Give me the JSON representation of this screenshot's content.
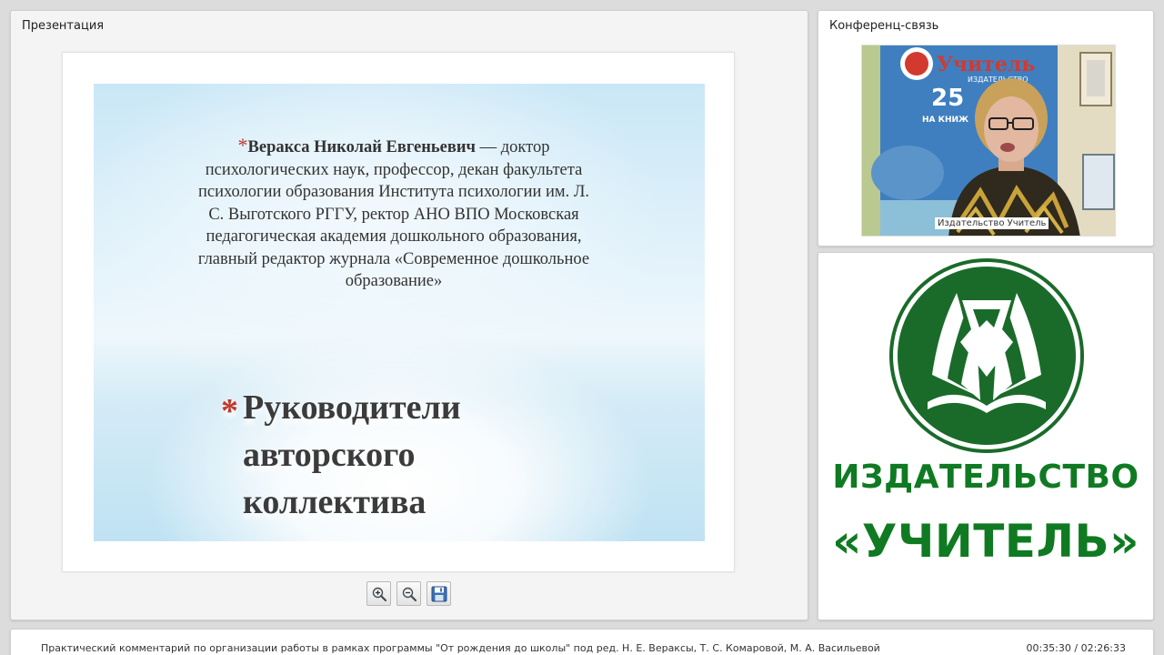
{
  "presentation": {
    "title": "Презентация",
    "slide": {
      "body_name": "Веракса Николай Евгеньевич",
      "body_text": " — доктор психологических наук, профессор, декан факультета психологии образования Института психологии им. Л. С. Выготского РГГУ, ректор АНО ВПО Московская педагогическая академия дошкольного образования, главный редактор журнала «Современное дошкольное образование»",
      "heading_lines": [
        "Руководители",
        "авторского",
        "коллектива"
      ],
      "bullet": "*"
    },
    "toolbar": {
      "zoom_in_icon": "zoom-in-icon",
      "zoom_out_icon": "zoom-out-icon",
      "save_icon": "save-icon"
    }
  },
  "video": {
    "title": "Конференц-связь",
    "speaker_label": "Издательство Учитель",
    "poster_text": "Учитель",
    "poster_sub": "ИЗДАТЕЛЬСТВО",
    "poster_number": "25",
    "poster_tagline": "НА КНИЖ"
  },
  "logo": {
    "line1": "ИЗДАТЕЛЬСТВО",
    "line2": "«УЧИТЕЛЬ»",
    "color": "#0f7a22"
  },
  "footer": {
    "course_title": "Практический комментарий по организации работы в рамках программы \"От рождения до школы\" под  ред.  Н. Е. Вераксы, Т. С. Комаровой, М. А. Васильевой",
    "time": "00:35:30 / 02:26:33"
  }
}
